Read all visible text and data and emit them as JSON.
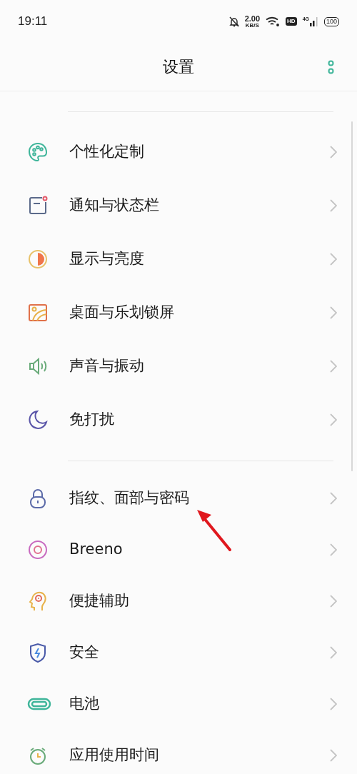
{
  "status_bar": {
    "time": "19:11",
    "speed": "2.00",
    "speed_unit": "KB/S",
    "hd": "HD",
    "network": "4G",
    "battery": "100"
  },
  "header": {
    "title": "设置"
  },
  "groups": [
    {
      "items": [
        {
          "label": "个性化定制"
        },
        {
          "label": "通知与状态栏"
        },
        {
          "label": "显示与亮度"
        },
        {
          "label": "桌面与乐划锁屏"
        },
        {
          "label": "声音与振动"
        },
        {
          "label": "免打扰"
        }
      ]
    },
    {
      "items": [
        {
          "label": "指纹、面部与密码"
        },
        {
          "label": "Breeno"
        },
        {
          "label": "便捷辅助"
        },
        {
          "label": "安全"
        },
        {
          "label": "电池"
        },
        {
          "label": "应用使用时间"
        }
      ]
    }
  ]
}
